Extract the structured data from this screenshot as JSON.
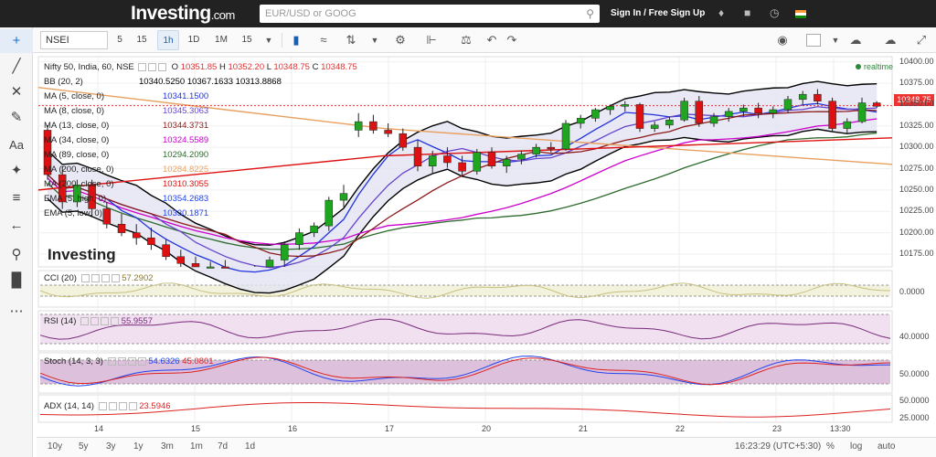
{
  "header": {
    "logo": "Investing",
    "logo_suffix": ".com",
    "search_placeholder": "EUR/USD or GOOG",
    "signin": "Sign In / Free Sign Up"
  },
  "toolbar": {
    "symbol": "NSEI",
    "intervals": [
      "5",
      "15",
      "1h",
      "1D",
      "1M",
      "15"
    ],
    "active_interval": "1h"
  },
  "chart": {
    "title_line": "Nifty 50, India, 60, NSE",
    "ohlc": {
      "o_label": "O",
      "o": "10351.85",
      "h_label": "H",
      "h": "10352.20",
      "l_label": "L",
      "l": "10348.75",
      "c_label": "C",
      "c": "10348.75"
    },
    "last_price": "10348.75",
    "realtime_label": "realtime",
    "watermark": "Investing",
    "overlays": [
      {
        "label": "BB (20, 2)",
        "value": "10340.5250 10367.1633 10313.8868",
        "color": "#000000"
      },
      {
        "label": "MA (5, close, 0)",
        "value": "10341.1500",
        "color": "#2233dd"
      },
      {
        "label": "MA (8, close, 0)",
        "value": "10345.3063",
        "color": "#6644cc"
      },
      {
        "label": "MA (13, close, 0)",
        "value": "10344.3731",
        "color": "#8b1a1a"
      },
      {
        "label": "MA (34, close, 0)",
        "value": "10324.5589",
        "color": "#cc00cc"
      },
      {
        "label": "MA (89, close, 0)",
        "value": "10294.2090",
        "color": "#2e6b2e"
      },
      {
        "label": "MA (200, close, 0)",
        "value": "10284.8225",
        "color": "#e8a060"
      },
      {
        "label": "MA (200, close, 0)",
        "value": "10310.3055",
        "color": "#dd1111"
      },
      {
        "label": "EMA (5, high, 0)",
        "value": "10354.2683",
        "color": "#2244ee"
      },
      {
        "label": "EMA (5, low, 0)",
        "value": "10330.1871",
        "color": "#2244ee"
      }
    ],
    "price_axis": [
      "10400.00",
      "10375.00",
      "10350.00",
      "10325.00",
      "10300.00",
      "10275.00",
      "10250.00",
      "10225.00",
      "10200.00",
      "10175.00"
    ],
    "time_axis": [
      "14",
      "15",
      "16",
      "17",
      "20",
      "21",
      "22",
      "23",
      "13:30"
    ]
  },
  "panes": {
    "cci": {
      "label": "CCI (20)",
      "value": "57.2902",
      "axis": [
        "0.0000"
      ]
    },
    "rsi": {
      "label": "RSI (14)",
      "value": "55.9557",
      "axis": [
        "40.0000"
      ]
    },
    "stoch": {
      "label": "Stoch (14, 3, 3)",
      "value1": "54.6326",
      "value2": "45.0801",
      "axis": [
        "50.0000"
      ]
    },
    "adx": {
      "label": "ADX (14, 14)",
      "value": "23.5946",
      "axis": [
        "50.0000",
        "25.0000"
      ]
    }
  },
  "bottom": {
    "ranges": [
      "10y",
      "5y",
      "3y",
      "1y",
      "3m",
      "1m",
      "7d",
      "1d"
    ],
    "clock": "16:23:29 (UTC+5:30)",
    "pct": "%",
    "log": "log",
    "auto": "auto"
  },
  "chart_data": {
    "type": "candlestick",
    "ylim": [
      10160,
      10405
    ],
    "x_ticks": [
      "14",
      "15",
      "16",
      "17",
      "20",
      "21",
      "22",
      "23",
      "13:30"
    ],
    "candles": [
      {
        "o": 10320,
        "h": 10326,
        "l": 10262,
        "c": 10268
      },
      {
        "o": 10268,
        "h": 10278,
        "l": 10228,
        "c": 10236
      },
      {
        "o": 10236,
        "h": 10262,
        "l": 10230,
        "c": 10256
      },
      {
        "o": 10256,
        "h": 10262,
        "l": 10218,
        "c": 10228
      },
      {
        "o": 10228,
        "h": 10236,
        "l": 10205,
        "c": 10210
      },
      {
        "o": 10210,
        "h": 10222,
        "l": 10196,
        "c": 10200
      },
      {
        "o": 10200,
        "h": 10210,
        "l": 10186,
        "c": 10194
      },
      {
        "o": 10194,
        "h": 10206,
        "l": 10180,
        "c": 10186
      },
      {
        "o": 10186,
        "h": 10192,
        "l": 10168,
        "c": 10172
      },
      {
        "o": 10172,
        "h": 10180,
        "l": 10158,
        "c": 10164
      },
      {
        "o": 10164,
        "h": 10172,
        "l": 10150,
        "c": 10156
      },
      {
        "o": 10156,
        "h": 10166,
        "l": 10145,
        "c": 10160
      },
      {
        "o": 10160,
        "h": 10168,
        "l": 10140,
        "c": 10146
      },
      {
        "o": 10146,
        "h": 10160,
        "l": 10136,
        "c": 10150
      },
      {
        "o": 10150,
        "h": 10162,
        "l": 10140,
        "c": 10158
      },
      {
        "o": 10158,
        "h": 10172,
        "l": 10150,
        "c": 10168
      },
      {
        "o": 10168,
        "h": 10190,
        "l": 10160,
        "c": 10186
      },
      {
        "o": 10186,
        "h": 10205,
        "l": 10180,
        "c": 10200
      },
      {
        "o": 10200,
        "h": 10212,
        "l": 10195,
        "c": 10208
      },
      {
        "o": 10208,
        "h": 10242,
        "l": 10202,
        "c": 10238
      },
      {
        "o": 10238,
        "h": 10256,
        "l": 10230,
        "c": 10246
      },
      {
        "o": 10320,
        "h": 10340,
        "l": 10312,
        "c": 10330
      },
      {
        "o": 10330,
        "h": 10338,
        "l": 10316,
        "c": 10320
      },
      {
        "o": 10320,
        "h": 10328,
        "l": 10312,
        "c": 10316
      },
      {
        "o": 10316,
        "h": 10322,
        "l": 10296,
        "c": 10300
      },
      {
        "o": 10300,
        "h": 10308,
        "l": 10272,
        "c": 10278
      },
      {
        "o": 10278,
        "h": 10296,
        "l": 10270,
        "c": 10290
      },
      {
        "o": 10290,
        "h": 10300,
        "l": 10276,
        "c": 10282
      },
      {
        "o": 10282,
        "h": 10290,
        "l": 10266,
        "c": 10272
      },
      {
        "o": 10272,
        "h": 10298,
        "l": 10268,
        "c": 10294
      },
      {
        "o": 10294,
        "h": 10300,
        "l": 10275,
        "c": 10278
      },
      {
        "o": 10278,
        "h": 10290,
        "l": 10270,
        "c": 10286
      },
      {
        "o": 10286,
        "h": 10296,
        "l": 10280,
        "c": 10292
      },
      {
        "o": 10292,
        "h": 10304,
        "l": 10288,
        "c": 10300
      },
      {
        "o": 10300,
        "h": 10306,
        "l": 10294,
        "c": 10298
      },
      {
        "o": 10298,
        "h": 10332,
        "l": 10296,
        "c": 10328
      },
      {
        "o": 10328,
        "h": 10338,
        "l": 10322,
        "c": 10334
      },
      {
        "o": 10334,
        "h": 10346,
        "l": 10330,
        "c": 10344
      },
      {
        "o": 10344,
        "h": 10350,
        "l": 10338,
        "c": 10348
      },
      {
        "o": 10348,
        "h": 10354,
        "l": 10342,
        "c": 10350
      },
      {
        "o": 10350,
        "h": 10352,
        "l": 10318,
        "c": 10322
      },
      {
        "o": 10322,
        "h": 10330,
        "l": 10318,
        "c": 10326
      },
      {
        "o": 10326,
        "h": 10336,
        "l": 10322,
        "c": 10332
      },
      {
        "o": 10332,
        "h": 10358,
        "l": 10330,
        "c": 10354
      },
      {
        "o": 10354,
        "h": 10360,
        "l": 10324,
        "c": 10328
      },
      {
        "o": 10328,
        "h": 10340,
        "l": 10324,
        "c": 10336
      },
      {
        "o": 10336,
        "h": 10346,
        "l": 10330,
        "c": 10342
      },
      {
        "o": 10342,
        "h": 10350,
        "l": 10336,
        "c": 10346
      },
      {
        "o": 10346,
        "h": 10352,
        "l": 10334,
        "c": 10340
      },
      {
        "o": 10340,
        "h": 10348,
        "l": 10334,
        "c": 10344
      },
      {
        "o": 10344,
        "h": 10360,
        "l": 10340,
        "c": 10356
      },
      {
        "o": 10356,
        "h": 10366,
        "l": 10350,
        "c": 10362
      },
      {
        "o": 10362,
        "h": 10368,
        "l": 10350,
        "c": 10354
      },
      {
        "o": 10354,
        "h": 10358,
        "l": 10318,
        "c": 10322
      },
      {
        "o": 10322,
        "h": 10334,
        "l": 10316,
        "c": 10330
      },
      {
        "o": 10330,
        "h": 10358,
        "l": 10328,
        "c": 10352
      },
      {
        "o": 10352,
        "h": 10354,
        "l": 10346,
        "c": 10348
      }
    ]
  }
}
